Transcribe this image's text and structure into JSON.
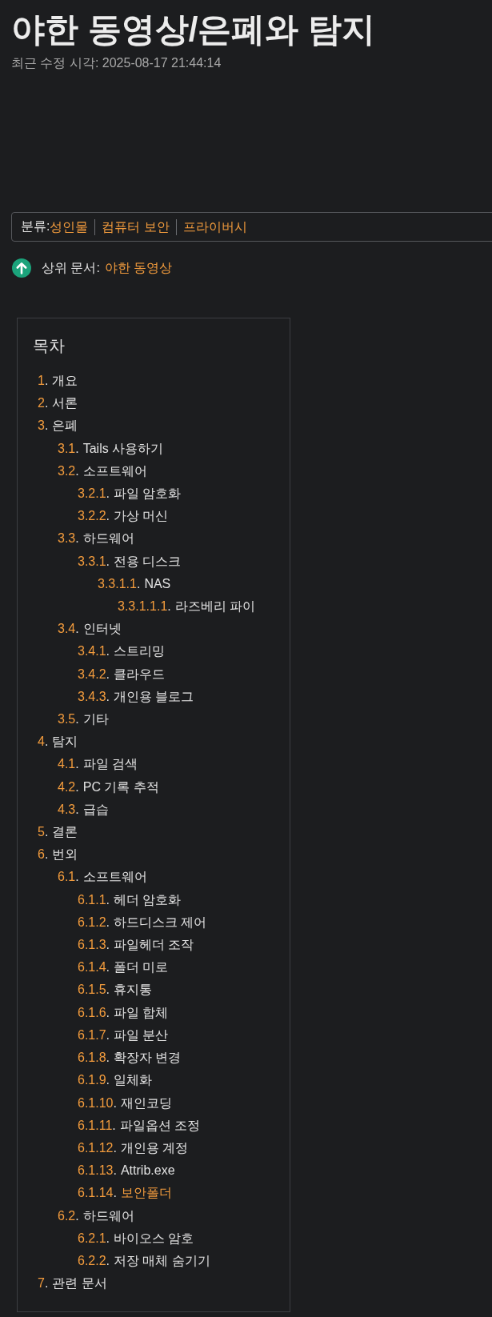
{
  "page": {
    "title": "야한 동영상/은폐와 탐지",
    "last_modified": "최근 수정 시각: 2025-08-17 21:44:14"
  },
  "categories": {
    "label": "분류:",
    "items": [
      "성인물",
      "컴퓨터 보안",
      "프라이버시"
    ]
  },
  "parent_document": {
    "label": "상위 문서:",
    "link": "야한 동영상"
  },
  "toc": {
    "title": "목차",
    "items": [
      {
        "number": "1.",
        "text": "개요",
        "highlighted": false
      },
      {
        "number": "2.",
        "text": "서론",
        "highlighted": false
      },
      {
        "number": "3.",
        "text": "은폐",
        "highlighted": false,
        "children": [
          {
            "number": "3.1.",
            "text": "Tails 사용하기",
            "highlighted": false
          },
          {
            "number": "3.2.",
            "text": "소프트웨어",
            "highlighted": false,
            "children": [
              {
                "number": "3.2.1.",
                "text": "파일 암호화",
                "highlighted": false
              },
              {
                "number": "3.2.2.",
                "text": "가상 머신",
                "highlighted": false
              }
            ]
          },
          {
            "number": "3.3.",
            "text": "하드웨어",
            "highlighted": false,
            "children": [
              {
                "number": "3.3.1.",
                "text": "전용 디스크",
                "highlighted": false,
                "children": [
                  {
                    "number": "3.3.1.1.",
                    "text": "NAS",
                    "highlighted": false,
                    "children": [
                      {
                        "number": "3.3.1.1.1.",
                        "text": "라즈베리 파이",
                        "highlighted": false
                      }
                    ]
                  }
                ]
              }
            ]
          },
          {
            "number": "3.4.",
            "text": "인터넷",
            "highlighted": false,
            "children": [
              {
                "number": "3.4.1.",
                "text": "스트리밍",
                "highlighted": false
              },
              {
                "number": "3.4.2.",
                "text": "클라우드",
                "highlighted": false
              },
              {
                "number": "3.4.3.",
                "text": "개인용 블로그",
                "highlighted": false
              }
            ]
          },
          {
            "number": "3.5.",
            "text": "기타",
            "highlighted": false
          }
        ]
      },
      {
        "number": "4.",
        "text": "탐지",
        "highlighted": false,
        "children": [
          {
            "number": "4.1.",
            "text": "파일 검색",
            "highlighted": false
          },
          {
            "number": "4.2.",
            "text": "PC 기록 추적",
            "highlighted": false
          },
          {
            "number": "4.3.",
            "text": "급습",
            "highlighted": false
          }
        ]
      },
      {
        "number": "5.",
        "text": "결론",
        "highlighted": false
      },
      {
        "number": "6.",
        "text": "번외",
        "highlighted": false,
        "children": [
          {
            "number": "6.1.",
            "text": "소프트웨어",
            "highlighted": false,
            "children": [
              {
                "number": "6.1.1.",
                "text": "헤더 암호화",
                "highlighted": false
              },
              {
                "number": "6.1.2.",
                "text": "하드디스크 제어",
                "highlighted": false
              },
              {
                "number": "6.1.3.",
                "text": "파일헤더 조작",
                "highlighted": false
              },
              {
                "number": "6.1.4.",
                "text": "폴더 미로",
                "highlighted": false
              },
              {
                "number": "6.1.5.",
                "text": "휴지통",
                "highlighted": false
              },
              {
                "number": "6.1.6.",
                "text": "파일 합체",
                "highlighted": false
              },
              {
                "number": "6.1.7.",
                "text": "파일 분산",
                "highlighted": false
              },
              {
                "number": "6.1.8.",
                "text": "확장자 변경",
                "highlighted": false
              },
              {
                "number": "6.1.9.",
                "text": "일체화",
                "highlighted": false
              },
              {
                "number": "6.1.10.",
                "text": "재인코딩",
                "highlighted": false
              },
              {
                "number": "6.1.11.",
                "text": "파일옵션 조정",
                "highlighted": false
              },
              {
                "number": "6.1.12.",
                "text": "개인용 계정",
                "highlighted": false
              },
              {
                "number": "6.1.13.",
                "text": "Attrib.exe",
                "highlighted": false
              },
              {
                "number": "6.1.14.",
                "text": "보안폴더",
                "highlighted": true
              }
            ]
          },
          {
            "number": "6.2.",
            "text": "하드웨어",
            "highlighted": false,
            "children": [
              {
                "number": "6.2.1.",
                "text": "바이오스 암호",
                "highlighted": false
              },
              {
                "number": "6.2.2.",
                "text": "저장 매체 숨기기",
                "highlighted": false
              }
            ]
          }
        ]
      },
      {
        "number": "7.",
        "text": "관련 문서",
        "highlighted": false
      }
    ]
  }
}
